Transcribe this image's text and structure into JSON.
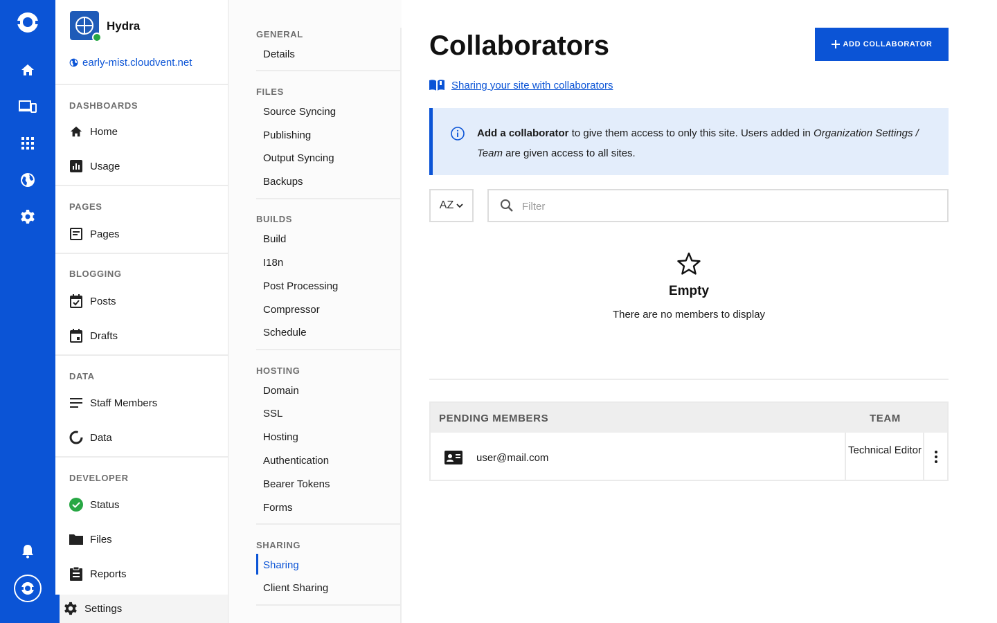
{
  "site": {
    "name": "Hydra",
    "url": "early-mist.cloudvent.net"
  },
  "sidebar": {
    "sections": [
      {
        "heading": "DASHBOARDS",
        "items": [
          "Home",
          "Usage"
        ]
      },
      {
        "heading": "PAGES",
        "items": [
          "Pages"
        ]
      },
      {
        "heading": "BLOGGING",
        "items": [
          "Posts",
          "Drafts"
        ]
      },
      {
        "heading": "DATA",
        "items": [
          "Staff Members",
          "Data"
        ]
      },
      {
        "heading": "DEVELOPER",
        "items": [
          "Status",
          "Files",
          "Reports"
        ]
      }
    ],
    "active_item": "Settings"
  },
  "settings_nav": {
    "general": {
      "heading": "GENERAL",
      "items": [
        "Details"
      ]
    },
    "files": {
      "heading": "FILES",
      "items": [
        "Source Syncing",
        "Publishing",
        "Output Syncing",
        "Backups"
      ]
    },
    "builds": {
      "heading": "BUILDS",
      "items": [
        "Build",
        "I18n",
        "Post Processing",
        "Compressor",
        "Schedule"
      ]
    },
    "hosting": {
      "heading": "HOSTING",
      "items": [
        "Domain",
        "SSL",
        "Hosting",
        "Authentication",
        "Bearer Tokens",
        "Forms"
      ]
    },
    "sharing": {
      "heading": "SHARING",
      "items": [
        "Sharing",
        "Client Sharing"
      ]
    },
    "active_item": "Sharing"
  },
  "main": {
    "title": "Collaborators",
    "add_button": "ADD COLLABORATOR",
    "help_link": "Sharing your site with collaborators",
    "info": {
      "bold": "Add a collaborator",
      "text1": " to give them access to only this site. Users added in ",
      "italic1": "Organization Settings / Team",
      "text2": " are given access to all sites."
    },
    "sort_label": "AZ",
    "filter_placeholder": "Filter",
    "empty_title": "Empty",
    "empty_text": "There are no members to display",
    "pending": {
      "header_members": "PENDING MEMBERS",
      "header_team": "TEAM",
      "rows": [
        {
          "email": "user@mail.com",
          "team": "Technical Editor"
        }
      ]
    }
  },
  "colors": {
    "brand": "#0b54d6",
    "info_bg": "#e3edfb",
    "status_green": "#27a744"
  }
}
